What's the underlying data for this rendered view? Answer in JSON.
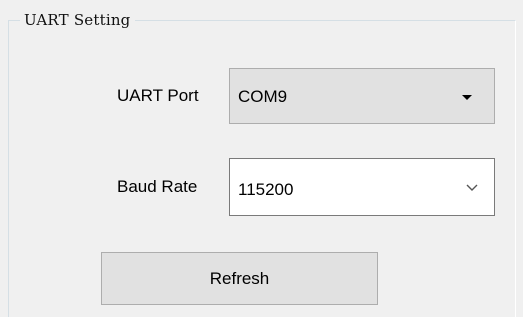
{
  "group": {
    "title": "UART Setting"
  },
  "uart_port": {
    "label": "UART Port",
    "selected": "COM9",
    "dropdown_icon": "triangle-down-icon"
  },
  "baud_rate": {
    "label": "Baud Rate",
    "value": "115200",
    "dropdown_icon": "chevron-down-icon"
  },
  "actions": {
    "refresh_label": "Refresh"
  },
  "colors": {
    "background": "#f0f0f0",
    "button_face": "#e1e1e1",
    "border": "#adadad"
  }
}
